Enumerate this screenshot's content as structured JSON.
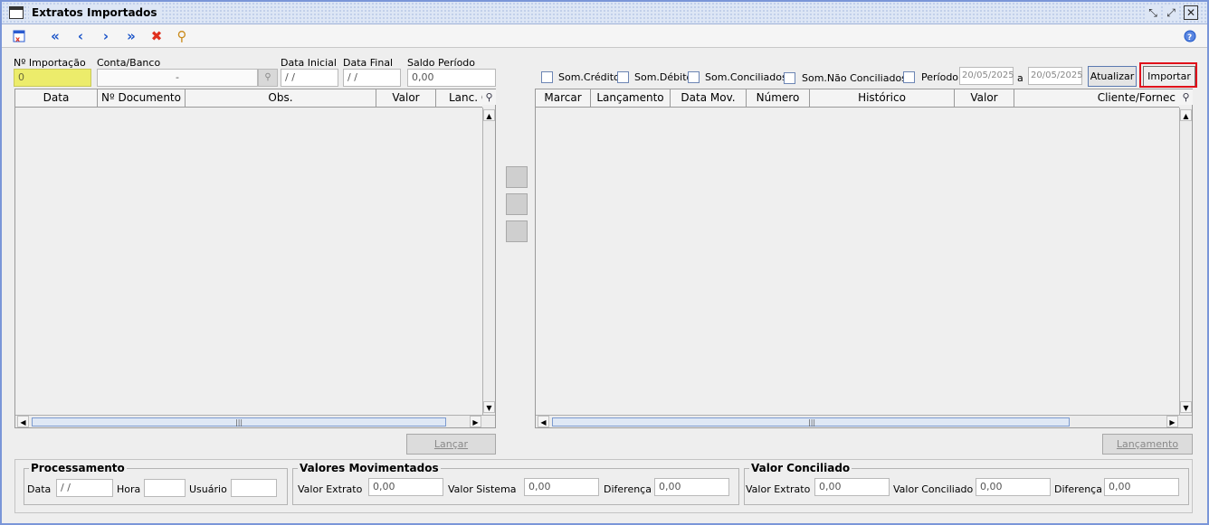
{
  "window": {
    "title": "Extratos Importados",
    "controls": [
      "restore-icon",
      "maximize-icon",
      "close-icon"
    ]
  },
  "toolbar": {
    "icons": [
      "report-icon",
      "first-record-icon",
      "previous-record-icon",
      "next-record-icon",
      "last-record-icon",
      "delete-icon",
      "search-icon",
      "help-icon"
    ]
  },
  "header_fields": {
    "importacao_label": "Nº Importação",
    "importacao_value": "0",
    "conta_label": "Conta/Banco",
    "conta_value": "-",
    "data_inicial_label": "Data Inicial",
    "data_inicial_value": "/ /",
    "data_final_label": "Data Final",
    "data_final_value": "/ /",
    "saldo_label": "Saldo Período",
    "saldo_value": "0,00"
  },
  "filters": {
    "som_credito": "Som.Crédito",
    "som_debito": "Som.Débito",
    "som_conciliados": "Som.Conciliados",
    "som_nao_conciliados": "Som.Não Conciliados",
    "periodo": "Período",
    "periodo_inicio": "20/05/2025",
    "periodo_sep": "a",
    "periodo_fim": "20/05/2025",
    "atualizar": "Atualizar",
    "importar": "Importar"
  },
  "left_grid": {
    "columns": [
      "Data",
      "Nº Documento",
      "Obs.",
      "Valor",
      "Lanc. C"
    ]
  },
  "right_grid": {
    "columns": [
      "Marcar",
      "Lançamento",
      "Data Mov.",
      "Número",
      "Histórico",
      "Valor",
      "Cliente/Fornec"
    ]
  },
  "buttons": {
    "lancar": "Lançar",
    "lancamento": "Lançamento"
  },
  "processamento": {
    "title": "Processamento",
    "data_label": "Data",
    "data_value": "/ /",
    "hora_label": "Hora",
    "hora_value": "",
    "usuario_label": "Usuário",
    "usuario_value": ""
  },
  "valores_movimentados": {
    "title": "Valores Movimentados",
    "extrato_label": "Valor Extrato",
    "extrato_value": "0,00",
    "sistema_label": "Valor Sistema",
    "sistema_value": "0,00",
    "diferenca_label": "Diferença",
    "diferenca_value": "0,00"
  },
  "valor_conciliado": {
    "title": "Valor Conciliado",
    "extrato_label": "Valor Extrato",
    "extrato_value": "0,00",
    "conciliado_label": "Valor Conciliado",
    "conciliado_value": "0,00",
    "diferenca_label": "Diferença",
    "diferenca_value": "0,00"
  },
  "colors": {
    "highlight": "#e0101a",
    "accent": "#1d56c9",
    "importacao_bg": "#ecec6b"
  }
}
